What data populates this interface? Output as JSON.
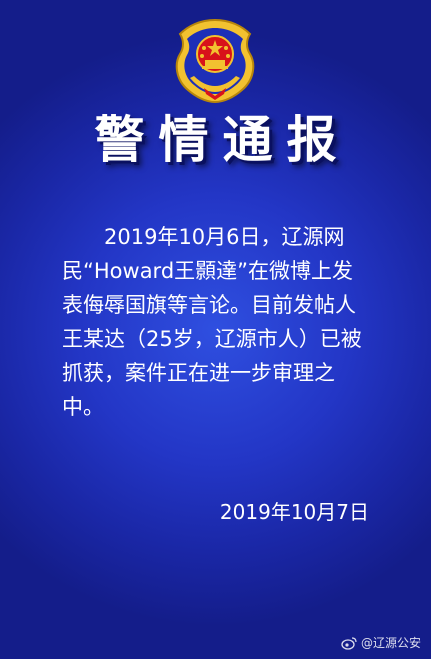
{
  "header": {
    "emblem_icon": "police-badge-emblem",
    "title": "警情通报"
  },
  "notice": {
    "body": "2019年10月6日，辽源网民“Howard王顥達”在微博上发表侮辱国旗等言论。目前发帖人王某达（25岁，辽源市人）已被抓获，案件正在进一步审理之中。",
    "date": "2019年10月7日"
  },
  "watermark": {
    "icon": "weibo-icon",
    "text": "@辽源公安"
  },
  "colors": {
    "background": "#2336c6",
    "text": "#ffffff",
    "emblem_gold": "#f2c230",
    "emblem_red": "#d8121a"
  }
}
